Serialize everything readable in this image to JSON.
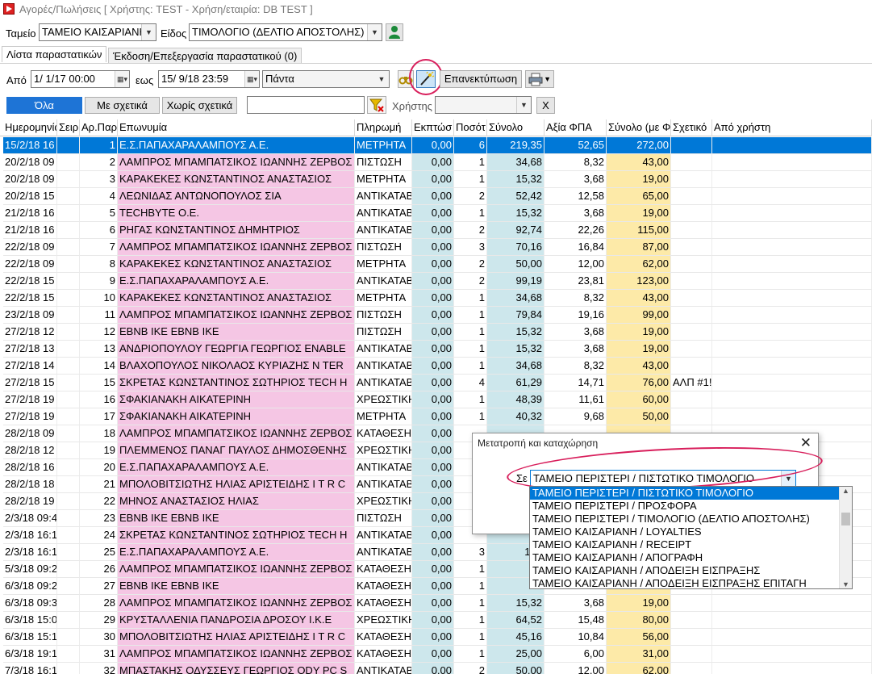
{
  "window": {
    "title": "Αγορές/Πωλήσεις   [ Χρήστης: TEST - Χρήση/εταιρία: DB TEST ]"
  },
  "toolbar1": {
    "tameio_label": "Ταμείο",
    "tameio_value": "ΤΑΜΕΙΟ ΚΑΙΣΑΡΙΑΝΗ",
    "eidos_label": "Είδος",
    "eidos_value": "ΤΙΜΟΛΟΓΙΟ (ΔΕΛΤΙΟ ΑΠΟΣΤΟΛΗΣ)"
  },
  "tabs": [
    {
      "label": "Λίστα παραστατικών"
    },
    {
      "label": "Έκδοση/Επεξεργασία παραστατικού (0)"
    }
  ],
  "filters": {
    "from_label": "Από",
    "from_value": "1/ 1/17 00:00",
    "to_label": "εως",
    "to_value": "15/ 9/18 23:59",
    "period_value": "Πάντα",
    "reprint_label": "Επανεκτύπωση",
    "all_label": "Όλα",
    "with_rel_label": "Με σχετικά",
    "without_rel_label": "Χωρίς σχετικά",
    "search_value": "",
    "user_label": "Χρήστης",
    "user_value": "",
    "clear_label": "X"
  },
  "grid": {
    "columns": [
      "Ημερομηνία",
      "Σειρ",
      "Αρ.Παρ",
      "Επωνυμία",
      "Πληρωμή",
      "Εκπτώσ",
      "Ποσότ",
      "Σύνολο",
      "Αξία ΦΠΑ",
      "Σύνολο (με Φ",
      "Σχετικό",
      "Από χρήστη"
    ],
    "rows": [
      [
        "15/2/18 16",
        "",
        "1",
        "Ε.Σ.ΠΑΠΑΧΑΡΑΛΑΜΠΟΥΣ Α.Ε.",
        "ΜΕΤΡΗΤΑ",
        "0,00",
        "6",
        "219,35",
        "52,65",
        "272,00",
        "",
        ""
      ],
      [
        "20/2/18 09",
        "",
        "2",
        "ΛΑΜΠΡΟΣ ΜΠΑΜΠΑΤΣΙΚΟΣ ΙΩΑΝΝΗΣ ΖΕΡΒΟΣ",
        "ΠΙΣΤΩΣΗ",
        "0,00",
        "1",
        "34,68",
        "8,32",
        "43,00",
        "",
        ""
      ],
      [
        "20/2/18 09",
        "",
        "3",
        "ΚΑΡΑΚΕΚΕΣ ΚΩΝΣΤΑΝΤΙΝΟΣ ΑΝΑΣΤΑΣΙΟΣ",
        "ΜΕΤΡΗΤΑ",
        "0,00",
        "1",
        "15,32",
        "3,68",
        "19,00",
        "",
        ""
      ],
      [
        "20/2/18 15",
        "",
        "4",
        "ΛΕΩΝΙΔΑΣ ΑΝΤΩΝΟΠΟΥΛΟΣ ΣΙΑ",
        "ΑΝΤΙΚΑΤΑΒ",
        "0,00",
        "2",
        "52,42",
        "12,58",
        "65,00",
        "",
        ""
      ],
      [
        "21/2/18 16",
        "",
        "5",
        "TECHBYTE O.E.",
        "ΑΝΤΙΚΑΤΑΒ",
        "0,00",
        "1",
        "15,32",
        "3,68",
        "19,00",
        "",
        ""
      ],
      [
        "21/2/18 16",
        "",
        "6",
        "ΡΗΓΑΣ ΚΩΝΣΤΑΝΤΙΝΟΣ ΔΗΜΗΤΡΙΟΣ",
        "ΑΝΤΙΚΑΤΑΒ",
        "0,00",
        "2",
        "92,74",
        "22,26",
        "115,00",
        "",
        ""
      ],
      [
        "22/2/18 09",
        "",
        "7",
        "ΛΑΜΠΡΟΣ ΜΠΑΜΠΑΤΣΙΚΟΣ ΙΩΑΝΝΗΣ ΖΕΡΒΟΣ",
        "ΠΙΣΤΩΣΗ",
        "0,00",
        "3",
        "70,16",
        "16,84",
        "87,00",
        "",
        ""
      ],
      [
        "22/2/18 09",
        "",
        "8",
        "ΚΑΡΑΚΕΚΕΣ ΚΩΝΣΤΑΝΤΙΝΟΣ ΑΝΑΣΤΑΣΙΟΣ",
        "ΜΕΤΡΗΤΑ",
        "0,00",
        "2",
        "50,00",
        "12,00",
        "62,00",
        "",
        ""
      ],
      [
        "22/2/18 15",
        "",
        "9",
        "Ε.Σ.ΠΑΠΑΧΑΡΑΛΑΜΠΟΥΣ Α.Ε.",
        "ΑΝΤΙΚΑΤΑΒ",
        "0,00",
        "2",
        "99,19",
        "23,81",
        "123,00",
        "",
        ""
      ],
      [
        "22/2/18 15",
        "",
        "10",
        "ΚΑΡΑΚΕΚΕΣ ΚΩΝΣΤΑΝΤΙΝΟΣ ΑΝΑΣΤΑΣΙΟΣ",
        "ΜΕΤΡΗΤΑ",
        "0,00",
        "1",
        "34,68",
        "8,32",
        "43,00",
        "",
        ""
      ],
      [
        "23/2/18 09",
        "",
        "11",
        "ΛΑΜΠΡΟΣ ΜΠΑΜΠΑΤΣΙΚΟΣ ΙΩΑΝΝΗΣ ΖΕΡΒΟΣ",
        "ΠΙΣΤΩΣΗ",
        "0,00",
        "1",
        "79,84",
        "19,16",
        "99,00",
        "",
        ""
      ],
      [
        "27/2/18 12",
        "",
        "12",
        "EBNB IKE   EBNB IKE",
        "ΠΙΣΤΩΣΗ",
        "0,00",
        "1",
        "15,32",
        "3,68",
        "19,00",
        "",
        ""
      ],
      [
        "27/2/18 13",
        "",
        "13",
        "ΑΝΔΡΙΟΠΟΥΛΟΥ ΓΕΩΡΓΙΑ ΓΕΩΡΓΙΟΣ  ENABLE",
        "ΑΝΤΙΚΑΤΑΒ",
        "0,00",
        "1",
        "15,32",
        "3,68",
        "19,00",
        "",
        ""
      ],
      [
        "27/2/18 14",
        "",
        "14",
        "ΒΛΑΧΟΠΟΥΛΟΣ ΝΙΚΟΛΑΟΣ ΚΥΡΙΑΖΗΣ   N TER",
        "ΑΝΤΙΚΑΤΑΒ",
        "0,00",
        "1",
        "34,68",
        "8,32",
        "43,00",
        "",
        ""
      ],
      [
        "27/2/18 15",
        "",
        "15",
        "ΣΚΡΕΤΑΣ ΚΩΝΣΤΑΝΤΙΝΟΣ ΣΩΤΗΡΙΟΣ   TECH H",
        "ΑΝΤΙΚΑΤΑΒ",
        "0,00",
        "4",
        "61,29",
        "14,71",
        "76,00",
        "ΑΛΠ #1!",
        ""
      ],
      [
        "27/2/18 19",
        "",
        "16",
        "ΣΦΑΚΙΑΝΑΚΗ ΑΙΚΑΤΕΡΙΝΗ",
        "ΧΡΕΩΣΤΙΚΗ",
        "0,00",
        "1",
        "48,39",
        "11,61",
        "60,00",
        "",
        ""
      ],
      [
        "27/2/18 19",
        "",
        "17",
        "ΣΦΑΚΙΑΝΑΚΗ ΑΙΚΑΤΕΡΙΝΗ",
        "ΜΕΤΡΗΤΑ",
        "0,00",
        "1",
        "40,32",
        "9,68",
        "50,00",
        "",
        ""
      ],
      [
        "28/2/18 09",
        "",
        "18",
        "ΛΑΜΠΡΟΣ ΜΠΑΜΠΑΤΣΙΚΟΣ ΙΩΑΝΝΗΣ ΖΕΡΒΟΣ",
        "ΚΑΤΑΘΕΣΗ",
        "0,00",
        "",
        "",
        "",
        "",
        "",
        ""
      ],
      [
        "28/2/18 12",
        "",
        "19",
        "ΠΛΕΜΜΕΝΟΣ ΠΑΝΑΓ ΠΑΥΛΟΣ ΔΗΜΟΣΘΕΝΗΣ",
        "ΧΡΕΩΣΤΙΚΗ",
        "0,00",
        "",
        "",
        "",
        "",
        "",
        ""
      ],
      [
        "28/2/18 16",
        "",
        "20",
        "Ε.Σ.ΠΑΠΑΧΑΡΑΛΑΜΠΟΥΣ Α.Ε.",
        "ΑΝΤΙΚΑΤΑΒ",
        "0,00",
        "",
        "",
        "",
        "",
        "",
        ""
      ],
      [
        "28/2/18 18",
        "",
        "21",
        "ΜΠΟΛΟΒΙΤΣΙΩΤΗΣ ΗΛΙΑΣ ΑΡΙΣΤΕΙΔΗΣ   I T R C",
        "ΑΝΤΙΚΑΤΑΒ",
        "0,00",
        "",
        "",
        "",
        "",
        "",
        ""
      ],
      [
        "28/2/18 19",
        "",
        "22",
        "ΜΗΝΟΣ ΑΝΑΣΤΑΣΙΟΣ ΗΛΙΑΣ",
        "ΧΡΕΩΣΤΙΚΗ",
        "0,00",
        "",
        "",
        "",
        "",
        "",
        ""
      ],
      [
        "2/3/18 09:4",
        "",
        "23",
        "EBNB IKE   EBNB IKE",
        "ΠΙΣΤΩΣΗ",
        "0,00",
        "",
        "",
        "",
        "",
        "",
        ""
      ],
      [
        "2/3/18 16:1",
        "",
        "24",
        "ΣΚΡΕΤΑΣ ΚΩΝΣΤΑΝΤΙΝΟΣ ΣΩΤΗΡΙΟΣ   TECH H",
        "ΑΝΤΙΚΑΤΑΒ",
        "0,00",
        "",
        "",
        "",
        "",
        "",
        ""
      ],
      [
        "2/3/18 16:1",
        "",
        "25",
        "Ε.Σ.ΠΑΠΑΧΑΡΑΛΑΜΠΟΥΣ Α.Ε.",
        "ΑΝΤΙΚΑΤΑΒ",
        "0,00",
        "3",
        "166",
        "",
        "",
        "",
        ""
      ],
      [
        "5/3/18 09:2",
        "",
        "26",
        "ΛΑΜΠΡΟΣ ΜΠΑΜΠΑΤΣΙΚΟΣ ΙΩΑΝΝΗΣ ΖΕΡΒΟΣ",
        "ΚΑΤΑΘΕΣΗ",
        "0,00",
        "1",
        "25",
        "",
        "",
        "",
        ""
      ],
      [
        "6/3/18 09:2",
        "",
        "27",
        "EBNB IKE   EBNB IKE",
        "ΚΑΤΑΘΕΣΗ",
        "0,00",
        "1",
        "15",
        "",
        "",
        "",
        ""
      ],
      [
        "6/3/18 09:3",
        "",
        "28",
        "ΛΑΜΠΡΟΣ ΜΠΑΜΠΑΤΣΙΚΟΣ ΙΩΑΝΝΗΣ ΖΕΡΒΟΣ",
        "ΚΑΤΑΘΕΣΗ",
        "0,00",
        "1",
        "15,32",
        "3,68",
        "19,00",
        "",
        ""
      ],
      [
        "6/3/18 15:0",
        "",
        "29",
        "ΚΡΥΣΤΑΛΛΕΝΙΑ ΠΑΝΔΡΟΣΙΑ ΔΡΟΣΟΥ I.K.E",
        "ΧΡΕΩΣΤΙΚΗ",
        "0,00",
        "1",
        "64,52",
        "15,48",
        "80,00",
        "",
        ""
      ],
      [
        "6/3/18 15:1",
        "",
        "30",
        "ΜΠΟΛΟΒΙΤΣΙΩΤΗΣ ΗΛΙΑΣ ΑΡΙΣΤΕΙΔΗΣ   I T R C",
        "ΚΑΤΑΘΕΣΗ",
        "0,00",
        "1",
        "45,16",
        "10,84",
        "56,00",
        "",
        ""
      ],
      [
        "6/3/18 19:1",
        "",
        "31",
        "ΛΑΜΠΡΟΣ ΜΠΑΜΠΑΤΣΙΚΟΣ ΙΩΑΝΝΗΣ ΖΕΡΒΟΣ",
        "ΚΑΤΑΘΕΣΗ",
        "0,00",
        "1",
        "25,00",
        "6,00",
        "31,00",
        "",
        ""
      ],
      [
        "7/3/18 16:1",
        "",
        "32",
        "ΜΠΑΣΤΑΚΗΣ ΟΔΥΣΣΕΥΣ ΓΕΩΡΓΙΟΣ   ODY PC S",
        "ΑΝΤΙΚΑΤΑΒ",
        "0,00",
        "2",
        "50,00",
        "12,00",
        "62,00",
        "",
        ""
      ]
    ]
  },
  "dialog": {
    "title": "Μετατροπή και καταχώρηση",
    "close": "✕",
    "to_label": "Σε",
    "selected": "ΤΑΜΕΙΟ ΠΕΡΙΣΤΕΡΙ / ΠΙΣΤΩΤΙΚΟ ΤΙΜΟΛΟΓΙΟ",
    "options": [
      "ΤΑΜΕΙΟ ΠΕΡΙΣΤΕΡΙ / ΠΙΣΤΩΤΙΚΟ ΤΙΜΟΛΟΓΙΟ",
      "ΤΑΜΕΙΟ ΠΕΡΙΣΤΕΡΙ / ΠΡΟΣΦΟΡΑ",
      "ΤΑΜΕΙΟ ΠΕΡΙΣΤΕΡΙ / ΤΙΜΟΛΟΓΙΟ (ΔΕΛΤΙΟ ΑΠΟΣΤΟΛΗΣ)",
      "ΤΑΜΕΙΟ ΚΑΙΣΑΡΙΑΝΗ / LOYALTIES",
      "ΤΑΜΕΙΟ ΚΑΙΣΑΡΙΑΝΗ / RECEIPT",
      "ΤΑΜΕΙΟ ΚΑΙΣΑΡΙΑΝΗ / ΑΠΟΓΡΑΦΗ",
      "ΤΑΜΕΙΟ ΚΑΙΣΑΡΙΑΝΗ / ΑΠΟΔΕΙΞΗ ΕΙΣΠΡΑΞΗΣ",
      "ΤΑΜΕΙΟ ΚΑΙΣΑΡΙΑΝΗ / ΑΠΟΔΕΙΞΗ ΕΙΣΠΡΑΞΗΣ ΕΠΙΤΑΓΗ"
    ]
  },
  "colors": {
    "accent": "#0078d7",
    "pink": "#f5c6e4",
    "teal": "#cde7ec",
    "yellow": "#fdeaa8",
    "annotation": "#d81e5b"
  },
  "icons": [
    "app-icon",
    "user-icon",
    "calendar-icon",
    "wand-icon",
    "print-icon",
    "filter-clear-icon"
  ]
}
